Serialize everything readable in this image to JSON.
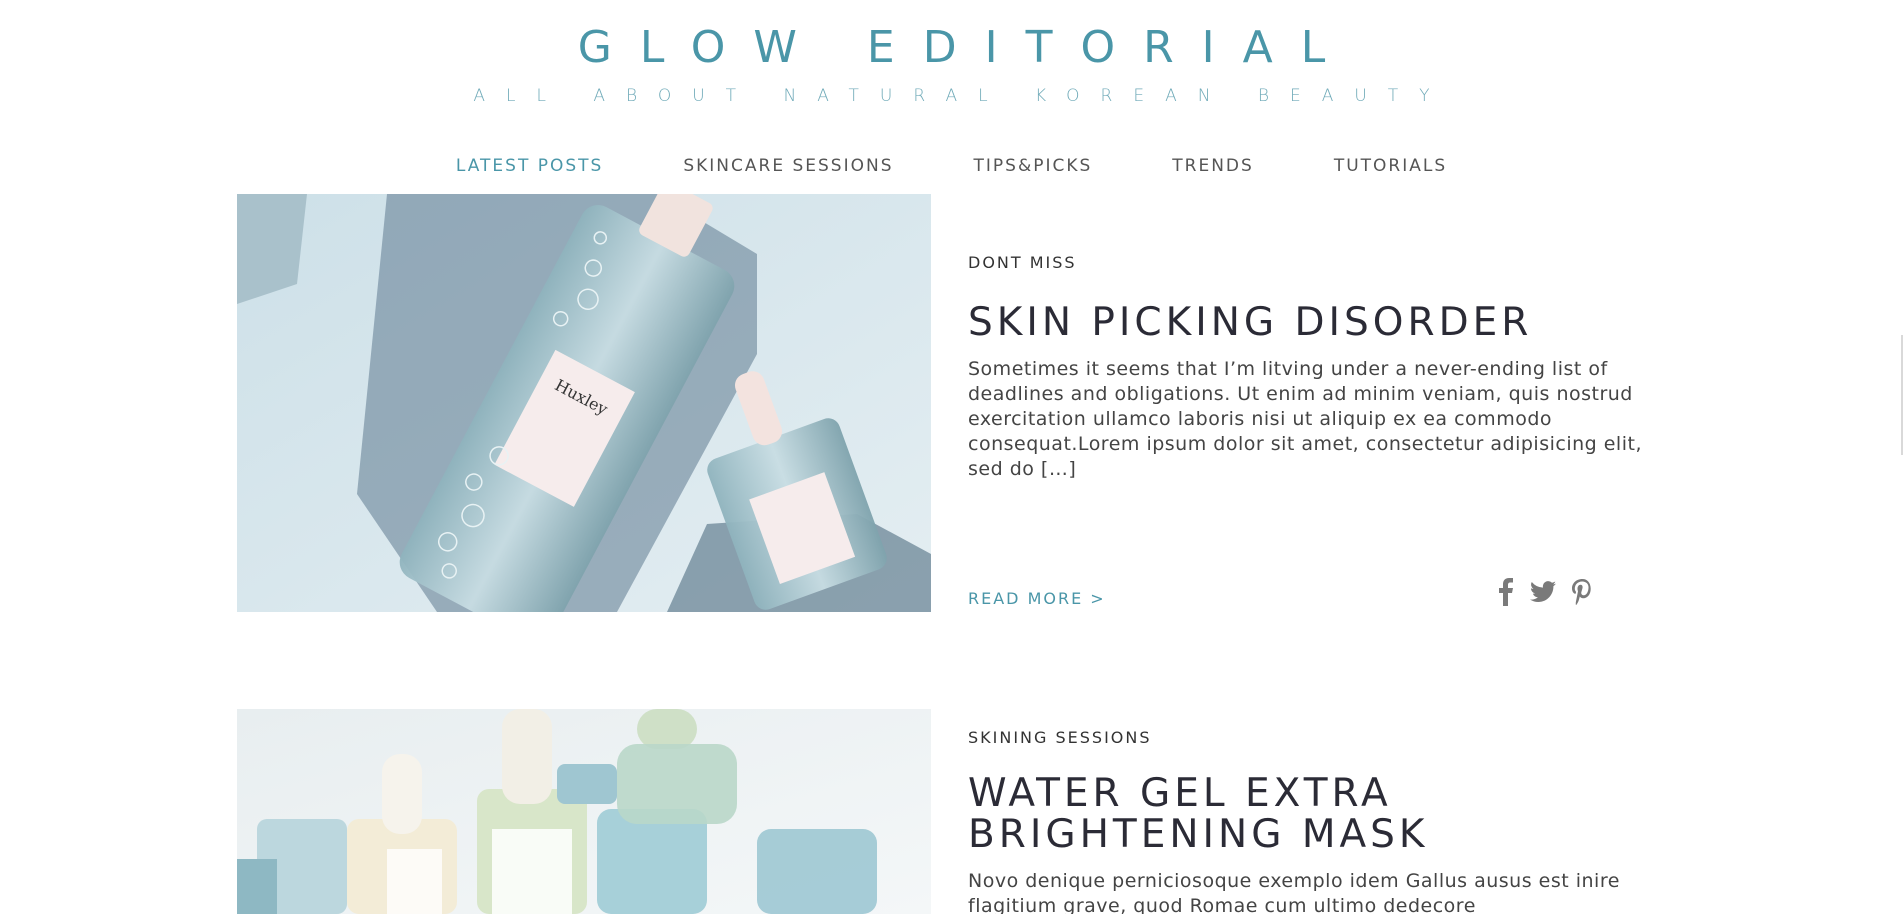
{
  "header": {
    "title": "GLOW EDITORIAL",
    "tagline": "ALL ABOUT NATURAL KOREAN BEAUTY"
  },
  "nav": {
    "items": [
      {
        "label": "LATEST POSTS",
        "active": true
      },
      {
        "label": "SKINCARE SESSIONS",
        "active": false
      },
      {
        "label": "TIPS&PICKS",
        "active": false
      },
      {
        "label": "TRENDS",
        "active": false
      },
      {
        "label": "TUTORIALS",
        "active": false
      }
    ]
  },
  "posts": [
    {
      "category": "DONT MISS",
      "title": "SKIN PICKING DISORDER",
      "excerpt": "Sometimes it seems that I’m litving under a never-ending list of deadlines and obligations. Ut enim ad minim veniam, quis nostrud exercitation ullamco laboris nisi ut aliquip ex ea commodo consequat.Lorem ipsum dolor sit amet, consectetur adipisicing elit, sed do […]",
      "read_more": "READ MORE >",
      "share_icons": [
        "facebook-icon",
        "twitter-icon",
        "pinterest-icon"
      ],
      "image_product_label": "Huxley"
    },
    {
      "category": "SKINING SESSIONS",
      "title_line1": "WATER GEL EXTRA",
      "title_line2": "BRIGHTENING MASK",
      "excerpt": "Novo denique perniciosoque exemplo idem Gallus ausus est inire flagitium grave, quod Romae cum ultimo dedecore"
    }
  ],
  "colors": {
    "accent": "#4a96a8",
    "heading": "#2b2b36",
    "body": "#444444"
  }
}
